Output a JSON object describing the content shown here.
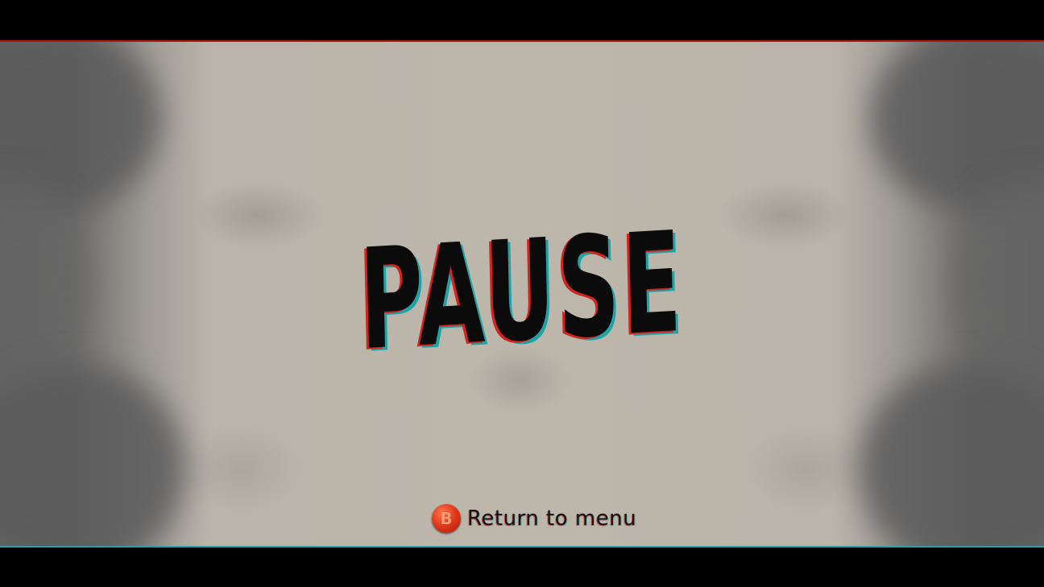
{
  "pause_menu": {
    "title": "PAUSE",
    "return_prompt": {
      "button_glyph": "B",
      "label": "Return to menu"
    }
  },
  "colors": {
    "background": "#bdb6ab",
    "edge_smoke": "#646464",
    "title_text": "#0b0b0b",
    "red_offset": "#d2251f",
    "cyan_offset": "#1da3a8",
    "button_red": "#e23a1c"
  }
}
